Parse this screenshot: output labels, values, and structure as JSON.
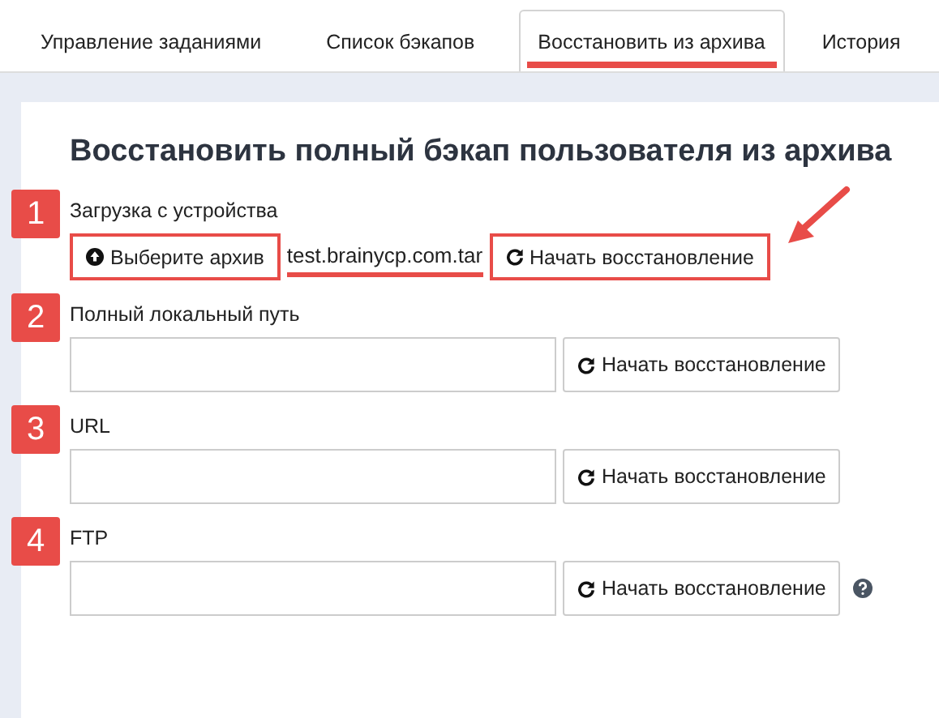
{
  "tabs": [
    {
      "label": "Управление заданиями",
      "selected": false
    },
    {
      "label": "Список бэкапов",
      "selected": false
    },
    {
      "label": "Восстановить из архива",
      "selected": true
    },
    {
      "label": "История",
      "selected": false
    }
  ],
  "heading": "Восстановить полный бэкап пользователя из архива",
  "sections": [
    {
      "kind": "upload",
      "number": "1",
      "label": "Загрузка с устройства",
      "choose_button": "Выберите архив",
      "file_name": "test.brainycp.com.tar",
      "restore_button": "Начать восстановление",
      "highlighted": true
    },
    {
      "kind": "field",
      "number": "2",
      "label": "Полный локальный путь",
      "restore_button": "Начать восстановление",
      "highlighted": false
    },
    {
      "kind": "field",
      "number": "3",
      "label": "URL",
      "restore_button": "Начать восстановление",
      "highlighted": false
    },
    {
      "kind": "field",
      "number": "4",
      "label": "FTP",
      "restore_button": "Начать восстановление",
      "highlighted": false,
      "help": true
    }
  ]
}
